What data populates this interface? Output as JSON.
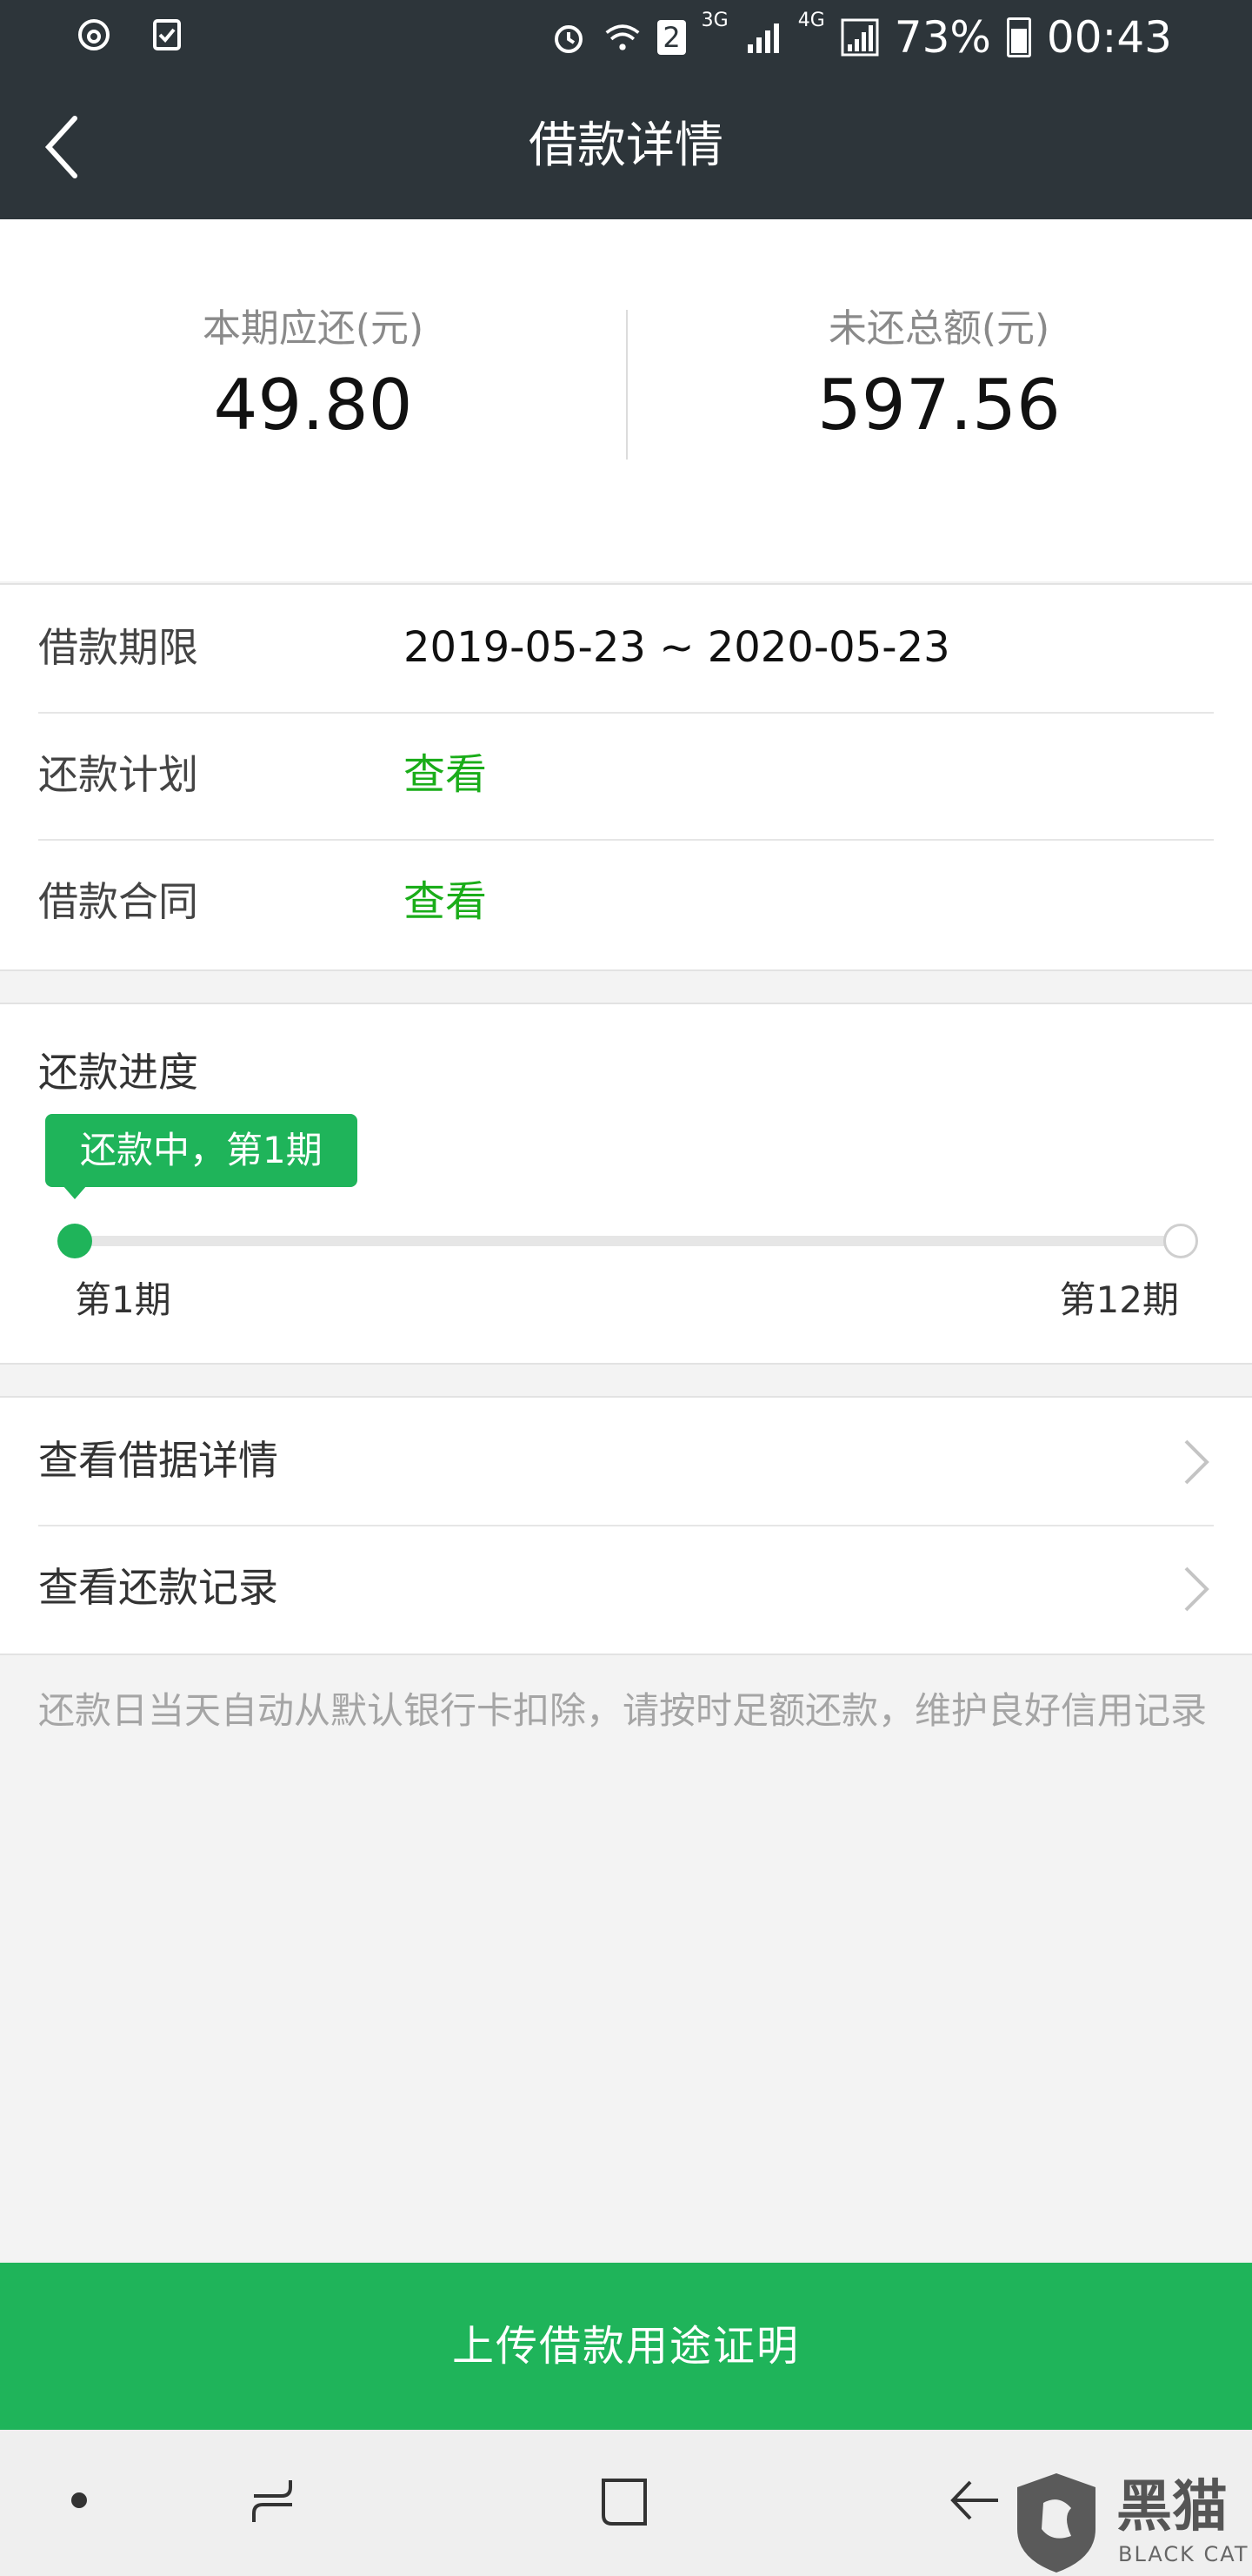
{
  "status_bar": {
    "network_3g": "3G",
    "network_4g": "4G",
    "battery": "73%",
    "time": "00:43",
    "sim_badge": "2"
  },
  "header": {
    "title": "借款详情"
  },
  "summary": {
    "current_due_label": "本期应还(元)",
    "current_due_value": "49.80",
    "total_outstanding_label": "未还总额(元)",
    "total_outstanding_value": "597.56"
  },
  "info": {
    "term_label": "借款期限",
    "term_value": "2019-05-23 ~ 2020-05-23",
    "plan_label": "还款计划",
    "plan_link": "查看",
    "contract_label": "借款合同",
    "contract_link": "查看"
  },
  "progress": {
    "title": "还款进度",
    "status_tip": "还款中，第1期",
    "start_label": "第1期",
    "end_label": "第12期",
    "current_period": 1,
    "total_periods": 12
  },
  "links": {
    "loan_details": "查看借据详情",
    "repayment_records": "查看还款记录"
  },
  "notice": "还款日当天自动从默认银行卡扣除，请按时足额还款，维护良好信用记录",
  "cta": {
    "label": "上传借款用途证明"
  },
  "watermark": {
    "title": "黑猫",
    "subtitle": "BLACK CAT"
  },
  "colors": {
    "accent": "#1fb45a",
    "header_bg": "#2d353a",
    "link": "#1aad19"
  }
}
